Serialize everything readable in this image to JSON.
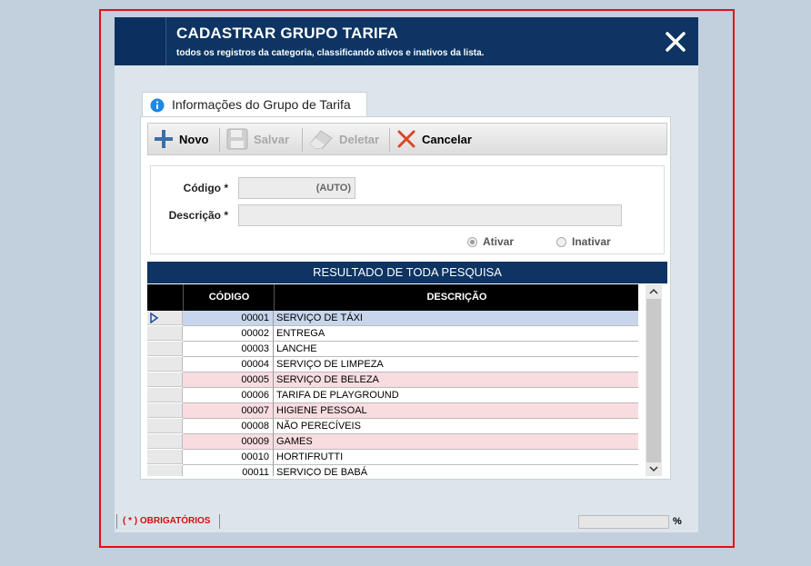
{
  "header": {
    "title": "CADASTRAR GRUPO TARIFA",
    "subtitle": "todos os registros da categoria, classificando ativos e inativos da lista."
  },
  "tab": {
    "label": "Informações do Grupo de Tarifa"
  },
  "toolbar": {
    "novo": "Novo",
    "salvar": "Salvar",
    "deletar": "Deletar",
    "cancelar": "Cancelar"
  },
  "form": {
    "codigo_label": "Código *",
    "codigo_value": "(AUTO)",
    "descricao_label": "Descrição *",
    "descricao_value": "",
    "ativar_label": "Ativar",
    "inativar_label": "Inativar",
    "status_selected": "Ativar"
  },
  "results": {
    "title": "RESULTADO DE TODA PESQUISA",
    "columns": [
      "CÓDIGO",
      "DESCRIÇÃO"
    ],
    "rows": [
      {
        "codigo": "00001",
        "descricao": "SERVIÇO DE TÁXI",
        "state": "selected"
      },
      {
        "codigo": "00002",
        "descricao": "ENTREGA",
        "state": "normal"
      },
      {
        "codigo": "00003",
        "descricao": "LANCHE",
        "state": "normal"
      },
      {
        "codigo": "00004",
        "descricao": "SERVIÇO DE LIMPEZA",
        "state": "normal"
      },
      {
        "codigo": "00005",
        "descricao": "SERVIÇO DE BELEZA",
        "state": "inactive"
      },
      {
        "codigo": "00006",
        "descricao": "TARIFA DE PLAYGROUND",
        "state": "normal"
      },
      {
        "codigo": "00007",
        "descricao": "HIGIENE PESSOAL",
        "state": "inactive"
      },
      {
        "codigo": "00008",
        "descricao": "NÃO PERECÍVEIS",
        "state": "normal"
      },
      {
        "codigo": "00009",
        "descricao": "GAMES",
        "state": "inactive"
      },
      {
        "codigo": "00010",
        "descricao": "HORTIFRUTTI",
        "state": "normal"
      },
      {
        "codigo": "00011",
        "descricao": "SERVIÇO DE BABÁ",
        "state": "normal"
      }
    ]
  },
  "footer": {
    "required_note": "( * ) OBRIGATÓRIOS",
    "percent_sign": "%"
  },
  "colors": {
    "header_bg": "#0d3463",
    "selected_row": "#c8d6ec",
    "inactive_row": "#f8dde0",
    "required_text": "#d01010",
    "frame_border": "#e0101a"
  }
}
